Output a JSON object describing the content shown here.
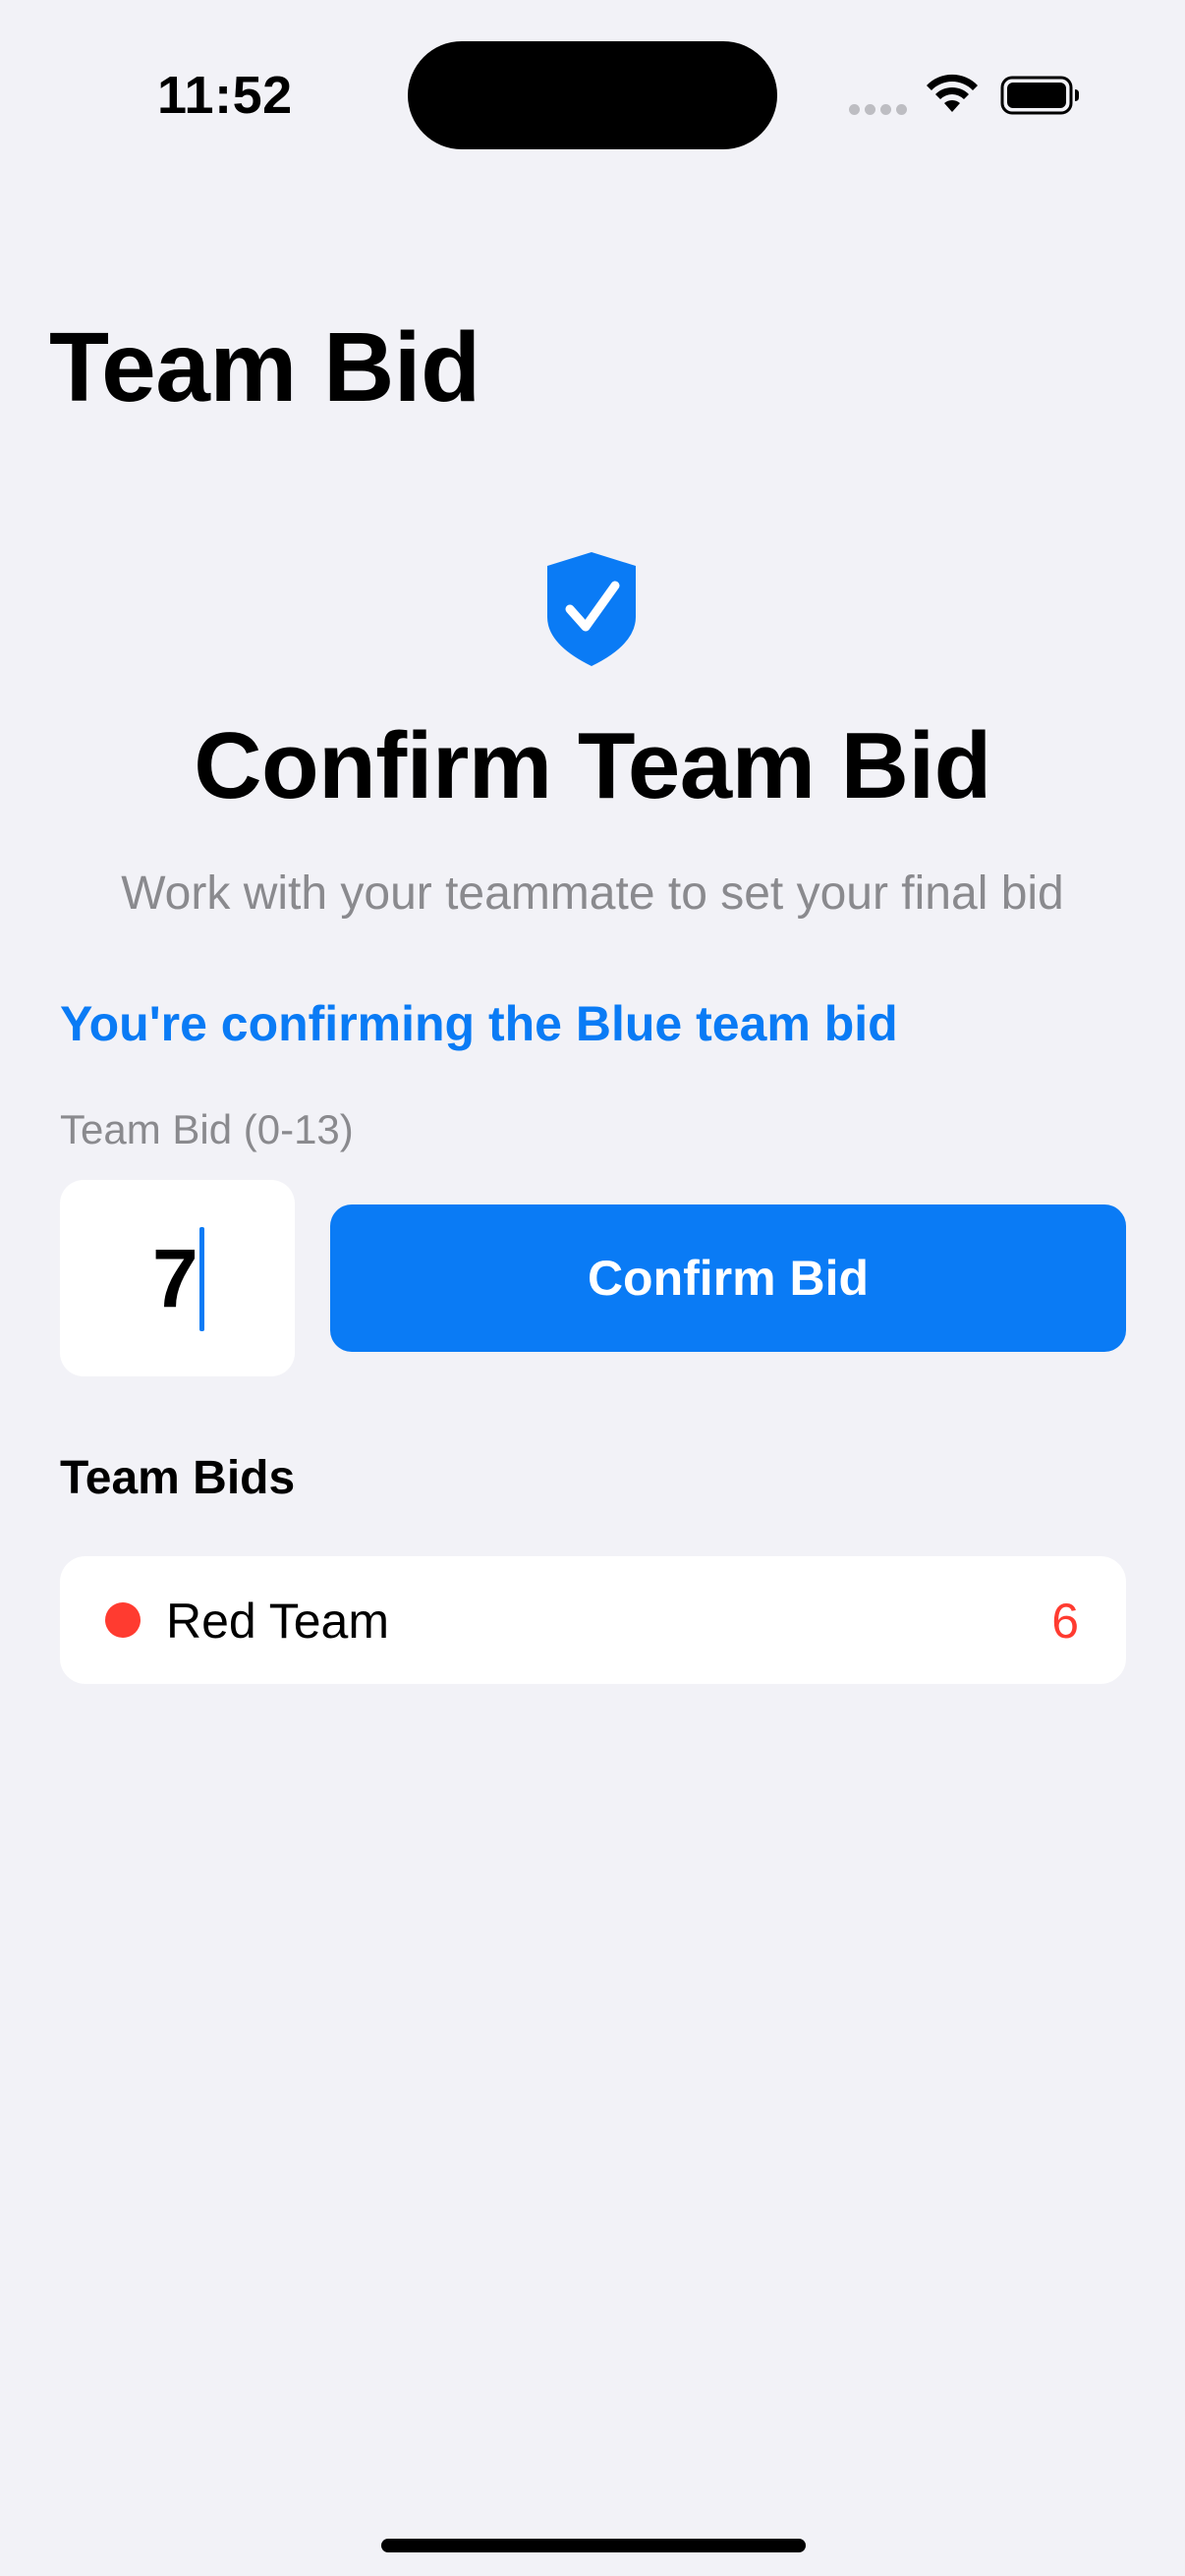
{
  "status_bar": {
    "time": "11:52"
  },
  "page": {
    "title": "Team Bid"
  },
  "header": {
    "icon": "checkmark-shield-icon",
    "title": "Confirm Team Bid",
    "subtitle": "Work with your teammate to set your final bid"
  },
  "confirming_note": "You're confirming the Blue team bid",
  "bid_form": {
    "label": "Team Bid (0-13)",
    "value": "7",
    "button_label": "Confirm Bid"
  },
  "team_bids": {
    "title": "Team Bids",
    "items": [
      {
        "name": "Red Team",
        "bid": "6",
        "color": "#FF3B30"
      }
    ]
  },
  "colors": {
    "accent": "#0A7BF5",
    "background": "#F2F2F7",
    "secondary_text": "#8A8A8E",
    "red_team": "#FF3B30"
  }
}
